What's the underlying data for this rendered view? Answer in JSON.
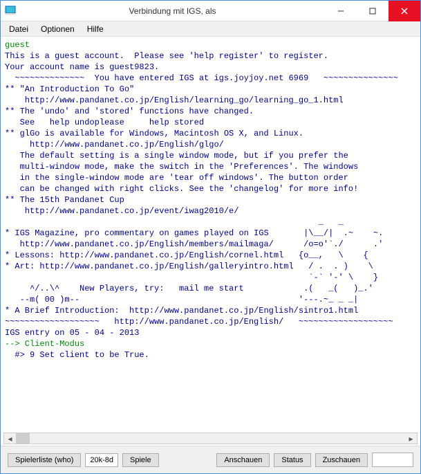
{
  "window": {
    "title": "Verbindung mit IGS, als"
  },
  "menu": {
    "file": "Datei",
    "options": "Optionen",
    "help": "Hilfe"
  },
  "terminal": {
    "l01": "guest",
    "l02": "This is a guest account.  Please see 'help register' to register.",
    "l03": "Your account name is guest9823.",
    "l04": "  ~~~~~~~~~~~~~~  You have entered IGS at igs.joyjoy.net 6969   ~~~~~~~~~~~~~~~",
    "l05": "** \"An Introduction To Go\"",
    "l06": "    http://www.pandanet.co.jp/English/learning_go/learning_go_1.html",
    "l07": "** The 'undo' and 'stored' functions have changed.",
    "l08": "   See   help undoplease     help stored",
    "l09": "** glGo is available for Windows, Macintosh OS X, and Linux.",
    "l10": "     http://www.pandanet.co.jp/English/glgo/",
    "l11": "   The default setting is a single window mode, but if you prefer the",
    "l12": "   multi-window mode, make the switch in the 'Preferences'. The windows",
    "l13": "   in the single-window mode are 'tear off windows'. The button order",
    "l14": "   can be changed with right clicks. See the 'changelog' for more info!",
    "l15": "** The 15th Pandanet Cup",
    "l16": "    http://www.pandanet.co.jp/event/iwag2010/e/",
    "l17": "                                                               _   _",
    "l18": "* IGS Magazine, pro commentary on games played on IGS       |\\__/|  .~    ~.",
    "l19": "   http://www.pandanet.co.jp/English/members/mailmaga/      /o=o'`./      .'",
    "l20": "* Lessons: http://www.pandanet.co.jp/English/cornel.html   {o__,   \\    {",
    "l21": "* Art: http://www.pandanet.co.jp/English/galleryintro.html   / .  . )    \\",
    "l22": "                                                             `-` '-' \\    }",
    "l23": "     ^/..\\^    New Players, try:   mail me start            .(   _(   )_.'",
    "l24": "   --m( 00 )m--                                            '---.~_ _ _|",
    "l25": "* A Brief Introduction:  http://www.pandanet.co.jp/English/sintro1.html",
    "l26": "~~~~~~~~~~~~~~~~~~~   http://www.pandanet.co.jp/English/   ~~~~~~~~~~~~~~~~~~~",
    "l27": "IGS entry on 05 - 04 - 2013",
    "l28": "--> Client-Modus",
    "l29": "  #> 9 Set client to be True."
  },
  "bottom": {
    "playerlist": "Spielerliste (who)",
    "rank": "20k-8d",
    "games": "Spiele",
    "watch": "Anschauen",
    "status": "Status",
    "observe": "Zuschauen"
  }
}
